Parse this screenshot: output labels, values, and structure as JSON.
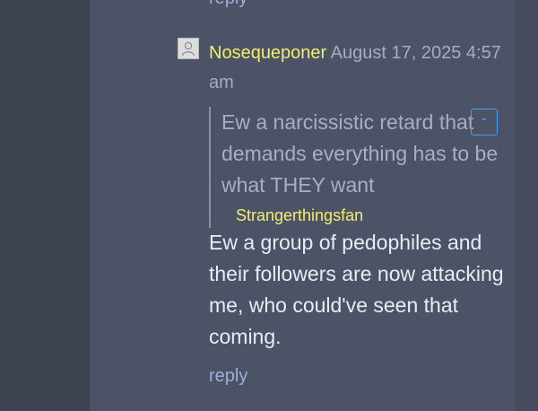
{
  "previous_comment": {
    "reply_label": "reply"
  },
  "comment": {
    "avatar_icon": "user-silhouette-icon",
    "author": "Nosequeponer",
    "timestamp": "August 17, 2025 4:57 am",
    "quote": {
      "text": "Ew a narcissistic retard that demands everything has to be what THEY want",
      "author": "Strangerthingsfan"
    },
    "collapse_label": "-",
    "body": "Ew a group of pedophiles and their followers are now attacking me, who could've seen that coming.",
    "reply_label": "reply"
  },
  "colors": {
    "author": "#f2ee6d",
    "link": "#9fb0d6",
    "panel": "#4c5366",
    "accent": "#3fa0f0"
  }
}
